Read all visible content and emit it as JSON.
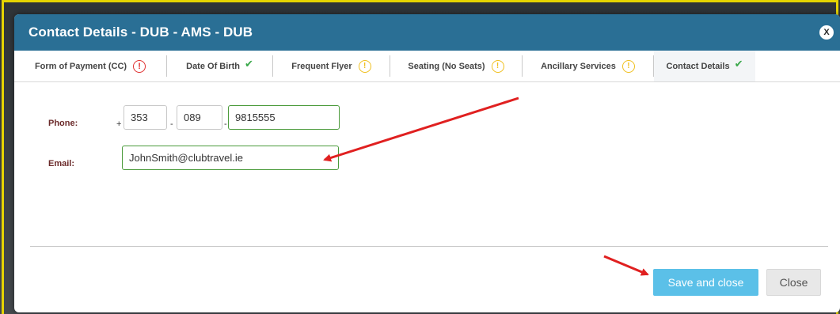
{
  "modal": {
    "title": "Contact Details - DUB - AMS - DUB",
    "close_label": "X"
  },
  "tabs": [
    {
      "label": "Form of Payment (CC)",
      "status": "error",
      "icon": "error-circle-icon"
    },
    {
      "label": "Date Of Birth",
      "status": "complete",
      "icon": "checkmark-icon"
    },
    {
      "label": "Frequent Flyer",
      "status": "warning",
      "icon": "warning-circle-icon"
    },
    {
      "label": "Seating (No Seats)",
      "status": "warning",
      "icon": "warning-circle-icon"
    },
    {
      "label": "Ancillary Services",
      "status": "warning",
      "icon": "warning-circle-icon"
    },
    {
      "label": "Contact Details",
      "status": "complete",
      "icon": "checkmark-icon",
      "active": true
    }
  ],
  "icons": {
    "error": "!",
    "warning": "!",
    "check": "✔"
  },
  "form": {
    "phone_label": "Phone:",
    "phone_plus": "+",
    "phone_dash": "-",
    "phone_country": "353",
    "phone_area": "089",
    "phone_number": "9815555",
    "email_label": "Email:",
    "email_value": "JohnSmith@clubtravel.ie"
  },
  "buttons": {
    "save_label": "Save and close",
    "close_label": "Close"
  },
  "colors": {
    "header": "#2a6f95",
    "save_button": "#5bc0e8",
    "annotation_arrow": "#e02020",
    "frame": "#e6d400"
  }
}
